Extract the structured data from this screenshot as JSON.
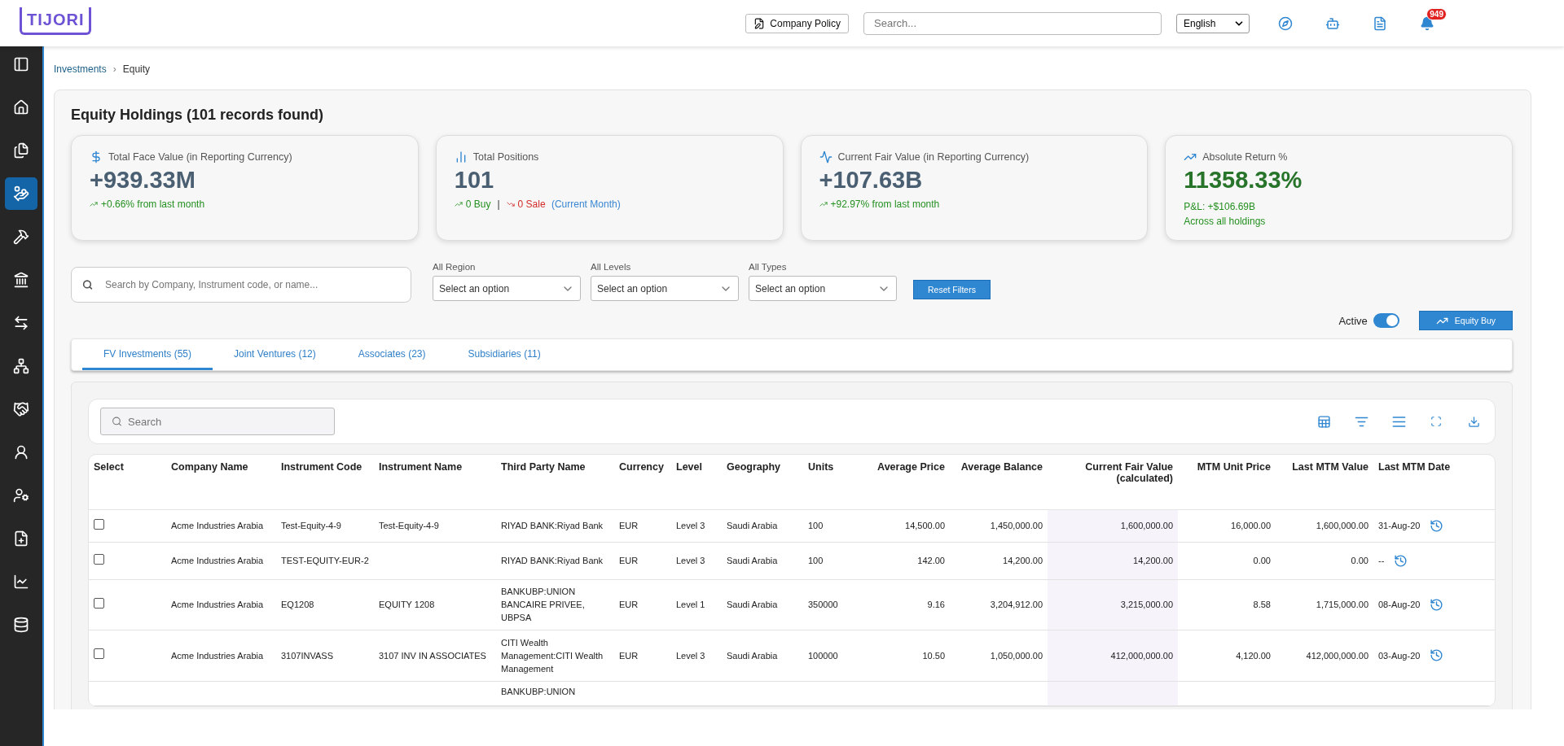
{
  "header": {
    "logo": "TIJORI",
    "policy_button": "Company Policy",
    "search_placeholder": "Search...",
    "language": "English",
    "notification_count": "949"
  },
  "sidebar": {
    "items": [
      {
        "kind": "panel",
        "selected": false
      },
      {
        "kind": "home",
        "selected": false
      },
      {
        "kind": "files",
        "selected": false
      },
      {
        "kind": "invest",
        "selected": true
      },
      {
        "kind": "hammer",
        "selected": false
      },
      {
        "kind": "bank",
        "selected": false
      },
      {
        "kind": "exchange",
        "selected": false
      },
      {
        "kind": "network",
        "selected": false
      },
      {
        "kind": "handshake",
        "selected": false
      },
      {
        "kind": "user",
        "selected": false
      },
      {
        "kind": "usercog",
        "selected": false
      },
      {
        "kind": "fileplus",
        "selected": false
      },
      {
        "kind": "chart",
        "selected": false
      },
      {
        "kind": "database",
        "selected": false
      }
    ]
  },
  "breadcrumb": {
    "items": [
      "Investments",
      "Equity"
    ],
    "separator": "›"
  },
  "title": "Equity Holdings (101 records found)",
  "cards": [
    {
      "kind": "face",
      "title": "Total Face Value (in Reporting Currency)",
      "value": "+939.33M",
      "trend": "+0.66% from last month"
    },
    {
      "kind": "positions",
      "title": "Total Positions",
      "value": "101",
      "buy": "0 Buy",
      "divider": "|",
      "sale": "0 Sale",
      "period": "(Current Month)"
    },
    {
      "kind": "fair",
      "title": "Current Fair Value (in Reporting Currency)",
      "value": "+107.63B",
      "trend": "+92.97% from last month"
    },
    {
      "kind": "return",
      "title": "Absolute Return %",
      "value": "11358.33%",
      "pnl": "P&L: +$106.69B",
      "note": "Across all holdings"
    }
  ],
  "filters": {
    "search_placeholder": "Search by Company, Instrument code, or name...",
    "selects": [
      {
        "label": "All Region",
        "placeholder": "Select an option"
      },
      {
        "label": "All Levels",
        "placeholder": "Select an option"
      },
      {
        "label": "All Types",
        "placeholder": "Select an option"
      }
    ],
    "reset": "Reset Filters"
  },
  "active_toggle": {
    "label": "Active",
    "on": true
  },
  "equity_buy": "Equity Buy",
  "tabs": [
    {
      "label": "FV Investments (55)",
      "selected": true
    },
    {
      "label": "Joint Ventures (12)",
      "selected": false
    },
    {
      "label": "Associates (23)",
      "selected": false
    },
    {
      "label": "Subsidiaries (11)",
      "selected": false
    }
  ],
  "table": {
    "search_placeholder": "Search",
    "columns": [
      "Select",
      "Company Name",
      "Instrument Code",
      "Instrument Name",
      "Third Party Name",
      "Currency",
      "Level",
      "Geography",
      "Units",
      "Average Price",
      "Average Balance",
      "Current Fair Value (calculated)",
      "MTM Unit Price",
      "Last MTM Value",
      "Last MTM Date"
    ],
    "rows": [
      {
        "checked": false,
        "company": "Acme Industries Arabia",
        "code": "Test-Equity-4-9",
        "name": "Test-Equity-4-9",
        "third_party": "RIYAD BANK:Riyad Bank",
        "currency": "EUR",
        "level": "Level 3",
        "geography": "Saudi Arabia",
        "units": "100",
        "avg_price": "14,500.00",
        "avg_balance": "1,450,000.00",
        "fair_value": "1,600,000.00",
        "mtm_price": "16,000.00",
        "mtm_value": "1,600,000.00",
        "mtm_date": "31-Aug-20"
      },
      {
        "checked": false,
        "company": "Acme Industries Arabia",
        "code": "TEST-EQUITY-EUR-2",
        "third_party": "RIYAD BANK:Riyad Bank",
        "currency": "EUR",
        "level": "Level 3",
        "geography": "Saudi Arabia",
        "units": "100",
        "avg_price": "142.00",
        "avg_balance": "14,200.00",
        "fair_value": "14,200.00",
        "mtm_price": "0.00",
        "mtm_value": "0.00",
        "mtm_date": "--"
      },
      {
        "checked": false,
        "company": "Acme Industries Arabia",
        "code": "EQ1208",
        "name": "EQUITY 1208",
        "third_party": "BANKUBP:UNION BANCAIRE PRIVEE, UBPSA",
        "currency": "EUR",
        "level": "Level 1",
        "geography": "Saudi Arabia",
        "units": "350000",
        "avg_price": "9.16",
        "avg_balance": "3,204,912.00",
        "fair_value": "3,215,000.00",
        "mtm_price": "8.58",
        "mtm_value": "1,715,000.00",
        "mtm_date": "08-Aug-20"
      },
      {
        "checked": false,
        "company": "Acme Industries Arabia",
        "code": "3107INVASS",
        "name": "3107 INV IN ASSOCIATES",
        "third_party": "CITI Wealth Management:CITI Wealth Management",
        "currency": "EUR",
        "level": "Level 3",
        "geography": "Saudi Arabia",
        "units": "100000",
        "avg_price": "10.50",
        "avg_balance": "1,050,000.00",
        "fair_value": "412,000,000.00",
        "mtm_price": "4,120.00",
        "mtm_value": "412,000,000.00",
        "mtm_date": "03-Aug-20"
      },
      {
        "third_party": "BANKUBP:UNION"
      }
    ]
  }
}
